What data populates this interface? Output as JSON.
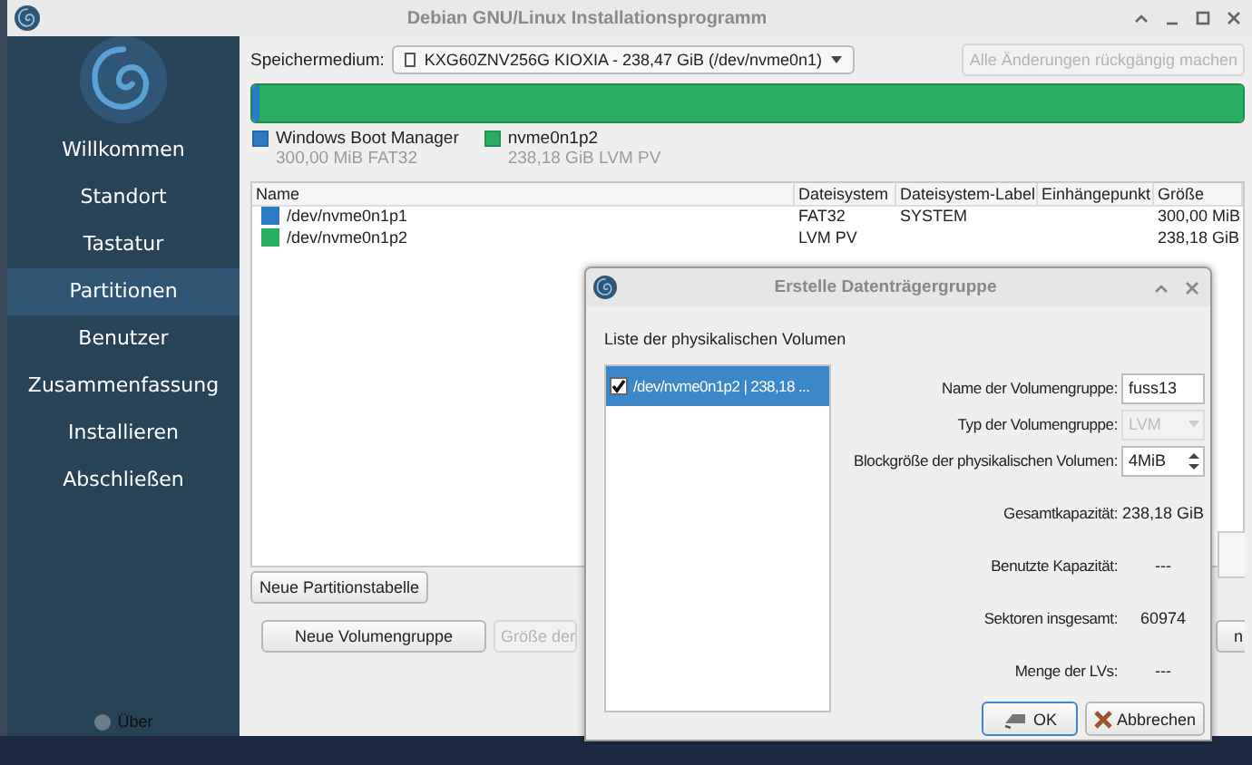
{
  "window": {
    "title": "Debian GNU/Linux Installationsprogramm"
  },
  "sidebar": {
    "items": [
      {
        "label": "Willkommen",
        "selected": false
      },
      {
        "label": "Standort",
        "selected": false
      },
      {
        "label": "Tastatur",
        "selected": false
      },
      {
        "label": "Partitionen",
        "selected": true
      },
      {
        "label": "Benutzer",
        "selected": false
      },
      {
        "label": "Zusammenfassung",
        "selected": false
      },
      {
        "label": "Installieren",
        "selected": false
      },
      {
        "label": "Abschließen",
        "selected": false
      }
    ],
    "about": "Über"
  },
  "storage": {
    "label": "Speichermedium:",
    "device": "KXG60ZNV256G KIOXIA - 238,47 GiB (/dev/nvme0n1)",
    "revert_button": {
      "label": "Alle Änderungen rückgängig machen",
      "disabled": true
    }
  },
  "disk_bar": {
    "segments": [
      {
        "color": "#2a7ac4",
        "level": 0.004
      },
      {
        "color": "#27ae60",
        "level": 0.996
      }
    ]
  },
  "legend": [
    {
      "name": "Windows Boot Manager",
      "detail": "300,00 MiB FAT32",
      "color": "#2a7ac4"
    },
    {
      "name": "nvme0n1p2",
      "detail": "238,18 GiB LVM PV",
      "color": "#27ae60"
    }
  ],
  "table": {
    "columns": [
      "Name",
      "Dateisystem",
      "Dateisystem-Label",
      "Einhängepunkt",
      "Größe"
    ],
    "rows": [
      {
        "color": "#2a7ac4",
        "cells": [
          "/dev/nvme0n1p1",
          "FAT32",
          "SYSTEM",
          "",
          "300,00 MiB"
        ]
      },
      {
        "color": "#27ae60",
        "cells": [
          "/dev/nvme0n1p2",
          "LVM PV",
          "",
          "",
          "238,18 GiB"
        ]
      }
    ]
  },
  "buttons": [
    {
      "label": "Neue Partitionstabelle",
      "disabled": false
    },
    {
      "label": "Neue Volumengruppe",
      "disabled": false
    },
    {
      "label": "Größe der",
      "disabled": true
    },
    {
      "label": "n",
      "disabled": false
    }
  ],
  "dialog": {
    "title": "Erstelle Datenträgergruppe",
    "list_title": "Liste der physikalischen Volumen",
    "volumes": [
      {
        "label": "/dev/nvme0n1p2 | 238,18 ...",
        "checked": true,
        "selected": true
      }
    ],
    "fields": [
      {
        "kind": "text",
        "label": "Name der Volumengruppe:",
        "value": "fuss13"
      },
      {
        "kind": "combo",
        "label": "Typ der Volumengruppe:",
        "value": "LVM",
        "disabled": true
      },
      {
        "kind": "spin",
        "label": "Blockgröße der physikalischen Volumen:",
        "value": "4MiB"
      },
      {
        "kind": "info",
        "label": "Gesamtkapazität:",
        "value": "238,18 GiB"
      },
      {
        "kind": "info",
        "label": "Benutzte Kapazität:",
        "value": "---"
      },
      {
        "kind": "info",
        "label": "Sektoren insgesamt:",
        "value": "60974"
      },
      {
        "kind": "info",
        "label": "Menge der LVs:",
        "value": "---"
      }
    ],
    "buttons": [
      {
        "kind": "ok",
        "label": "OK"
      },
      {
        "kind": "cancel",
        "label": "Abbrechen"
      }
    ]
  }
}
